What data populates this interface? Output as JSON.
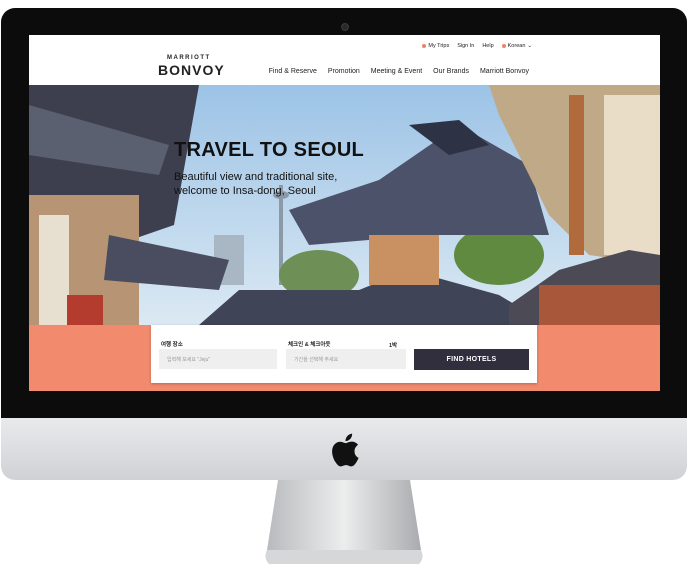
{
  "brand": {
    "top": "MARRIOTT",
    "bottom": "BONVOY"
  },
  "util_nav": {
    "my_trips": "My Trips",
    "sign_in": "Sign In",
    "help": "Help",
    "language": "Korean"
  },
  "main_nav": [
    "Find & Reserve",
    "Promotion",
    "Meeting & Event",
    "Our Brands",
    "Marriott Bonvoy"
  ],
  "hero": {
    "title": "TRAVEL TO SEOUL",
    "subtitle": "Beautiful view and traditional site, welcome to Insa-dong, Seoul"
  },
  "search": {
    "destination_label": "여행 장소",
    "destination_placeholder": "입력해 보세요 \"Jeju\"",
    "dates_label": "체크인 & 체크아웃",
    "dates_placeholder": "기간을 선택해 주세요",
    "nights": "1박",
    "find_button": "FIND HOTELS"
  },
  "colors": {
    "accent": "#f28b6e",
    "button": "#312e3e"
  },
  "icons": {
    "apple": "apple-logo-icon",
    "camera": "webcam-icon"
  }
}
